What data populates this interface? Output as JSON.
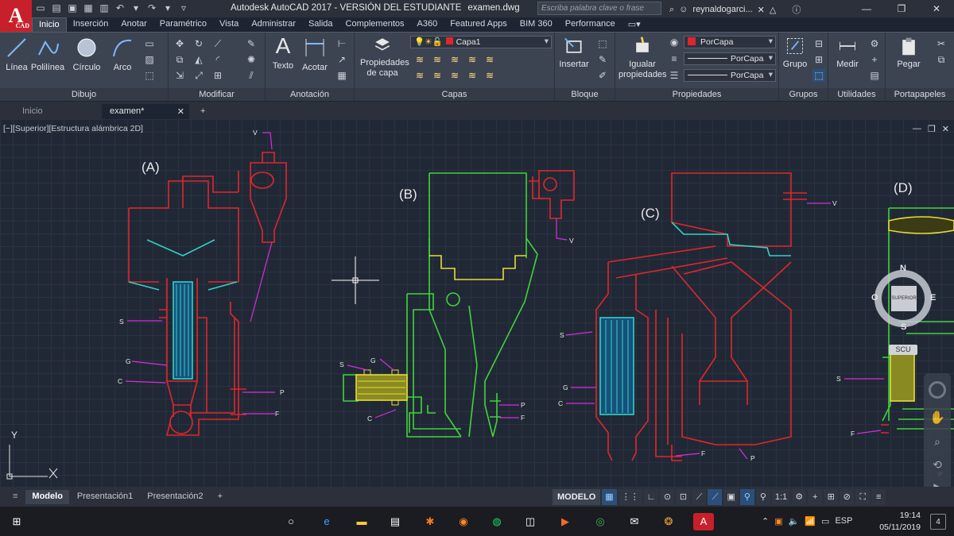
{
  "app": {
    "logo": "A",
    "logo_sub": "CAD",
    "title": "Autodesk AutoCAD 2017 - VERSIÓN DEL ESTUDIANTE",
    "filename": "examen.dwg",
    "search_placeholder": "Escriba palabra clave o frase",
    "username": "reynaldogarci..."
  },
  "ribbon_tabs": [
    "Inicio",
    "Inserción",
    "Anotar",
    "Paramétrico",
    "Vista",
    "Administrar",
    "Salida",
    "Complementos",
    "A360",
    "Featured Apps",
    "BIM 360",
    "Performance"
  ],
  "panels": {
    "dibujo": {
      "title": "Dibujo",
      "tools": [
        "Línea",
        "Polilínea",
        "Círculo",
        "Arco"
      ]
    },
    "modificar": {
      "title": "Modificar"
    },
    "anotacion": {
      "title": "Anotación",
      "tools": [
        "Texto",
        "Acotar"
      ]
    },
    "capas": {
      "title": "Capas",
      "props_label": "Propiedades de capa",
      "layer_value": "Capa1"
    },
    "bloque": {
      "title": "Bloque",
      "tool": "Insertar"
    },
    "propiedades": {
      "title": "Propiedades",
      "match_label": "Igualar propiedades",
      "color_value": "PorCapa",
      "linetype_value": "PorCapa",
      "lineweight_value": "PorCapa"
    },
    "grupos": {
      "title": "Grupos",
      "tool": "Grupo"
    },
    "utilidades": {
      "title": "Utilidades",
      "tool": "Medir"
    },
    "portapapeles": {
      "title": "Portapapeles",
      "tool": "Pegar"
    }
  },
  "doc_tabs": [
    "Inicio",
    "examen*"
  ],
  "viewport_label": "[−][Superior][Estructura alámbrica 2D]",
  "drawing": {
    "labels": [
      "(A)",
      "(B)",
      "(C)",
      "(D)"
    ],
    "callouts": {
      "v": "V",
      "s": "S",
      "g": "G",
      "c": "C",
      "p": "P",
      "f": "F"
    }
  },
  "navcube": {
    "n": "N",
    "s": "S",
    "e": "E",
    "o": "O",
    "face": "SUPERIOR",
    "wcs": "SCU"
  },
  "ucs": {
    "y": "Y"
  },
  "layout_tabs": [
    "Modelo",
    "Presentación1",
    "Presentación2"
  ],
  "status": {
    "model": "MODELO",
    "scale": "1:1"
  },
  "taskbar": {
    "lang": "ESP",
    "time": "19:14",
    "date": "05/11/2019",
    "notifications": "4"
  },
  "colors": {
    "red": "#e0262d",
    "green": "#3fd43a",
    "cyan": "#2fd3c9",
    "yellow": "#e6dc3a",
    "magenta": "#d62ddc",
    "accent": "#2c4f7a"
  }
}
